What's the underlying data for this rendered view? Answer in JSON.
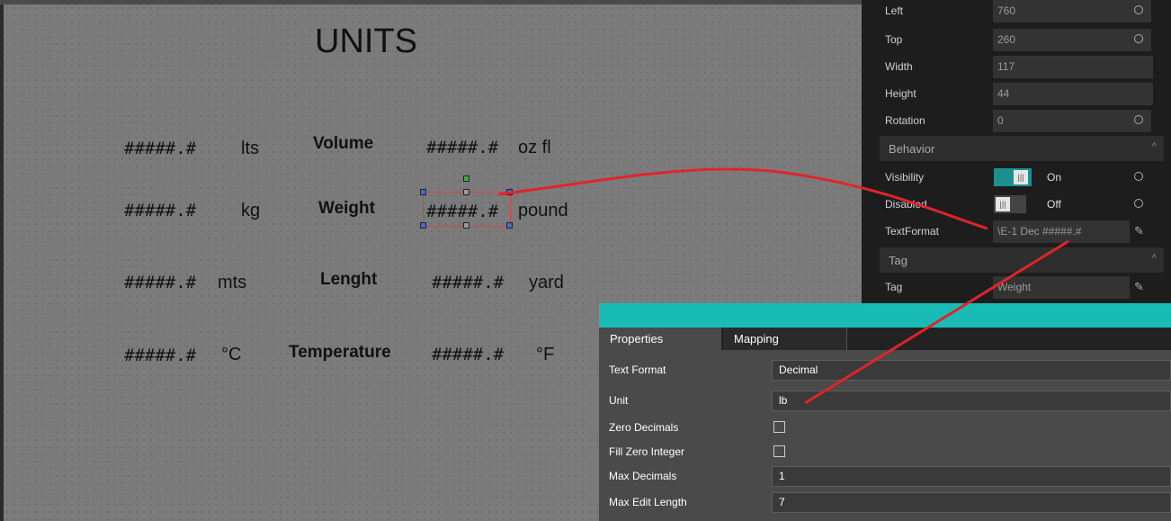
{
  "canvas": {
    "title": "UNITS",
    "rows": [
      {
        "left_value": "#####.#",
        "left_unit": "lts",
        "label": "Volume",
        "right_value": "#####.#",
        "right_unit": "oz fl"
      },
      {
        "left_value": "#####.#",
        "left_unit": "kg",
        "label": "Weight",
        "right_value": "#####.#",
        "right_unit": "pound"
      },
      {
        "left_value": "#####.#",
        "left_unit": "mts",
        "label": "Lenght",
        "right_value": "#####.#",
        "right_unit": "yard"
      },
      {
        "left_value": "#####.#",
        "left_unit": "°C",
        "label": "Temperature",
        "right_value": "#####.#",
        "right_unit": "°F"
      }
    ]
  },
  "properties_panel": {
    "left": {
      "label": "Left",
      "value": "760"
    },
    "top": {
      "label": "Top",
      "value": "260"
    },
    "width": {
      "label": "Width",
      "value": "117"
    },
    "height": {
      "label": "Height",
      "value": "44"
    },
    "rotation": {
      "label": "Rotation",
      "value": "0"
    },
    "behavior_section": "Behavior",
    "visibility": {
      "label": "Visibility",
      "state": "On"
    },
    "disabled": {
      "label": "Disabled",
      "state": "Off"
    },
    "text_format": {
      "label": "TextFormat",
      "value": "\\E-1 Dec #####.#"
    },
    "tag_section": "Tag",
    "tag": {
      "label": "Tag",
      "value": "Weight"
    }
  },
  "dialog": {
    "tabs": [
      "Properties",
      "Mapping"
    ],
    "text_format": {
      "label": "Text Format",
      "value": "Decimal"
    },
    "unit": {
      "label": "Unit",
      "value": "lb"
    },
    "zero_decimals": {
      "label": "Zero Decimals",
      "checked": false
    },
    "fill_zero_integer": {
      "label": "Fill Zero Integer",
      "checked": false
    },
    "max_decimals": {
      "label": "Max Decimals",
      "value": "1"
    },
    "max_edit_length": {
      "label": "Max Edit Length",
      "value": "7"
    }
  },
  "colors": {
    "accent": "#19bcb4",
    "annotation_line": "#e0242a",
    "canvas_bg": "#7b7b7b",
    "panel_bg": "#1d1d1d"
  }
}
